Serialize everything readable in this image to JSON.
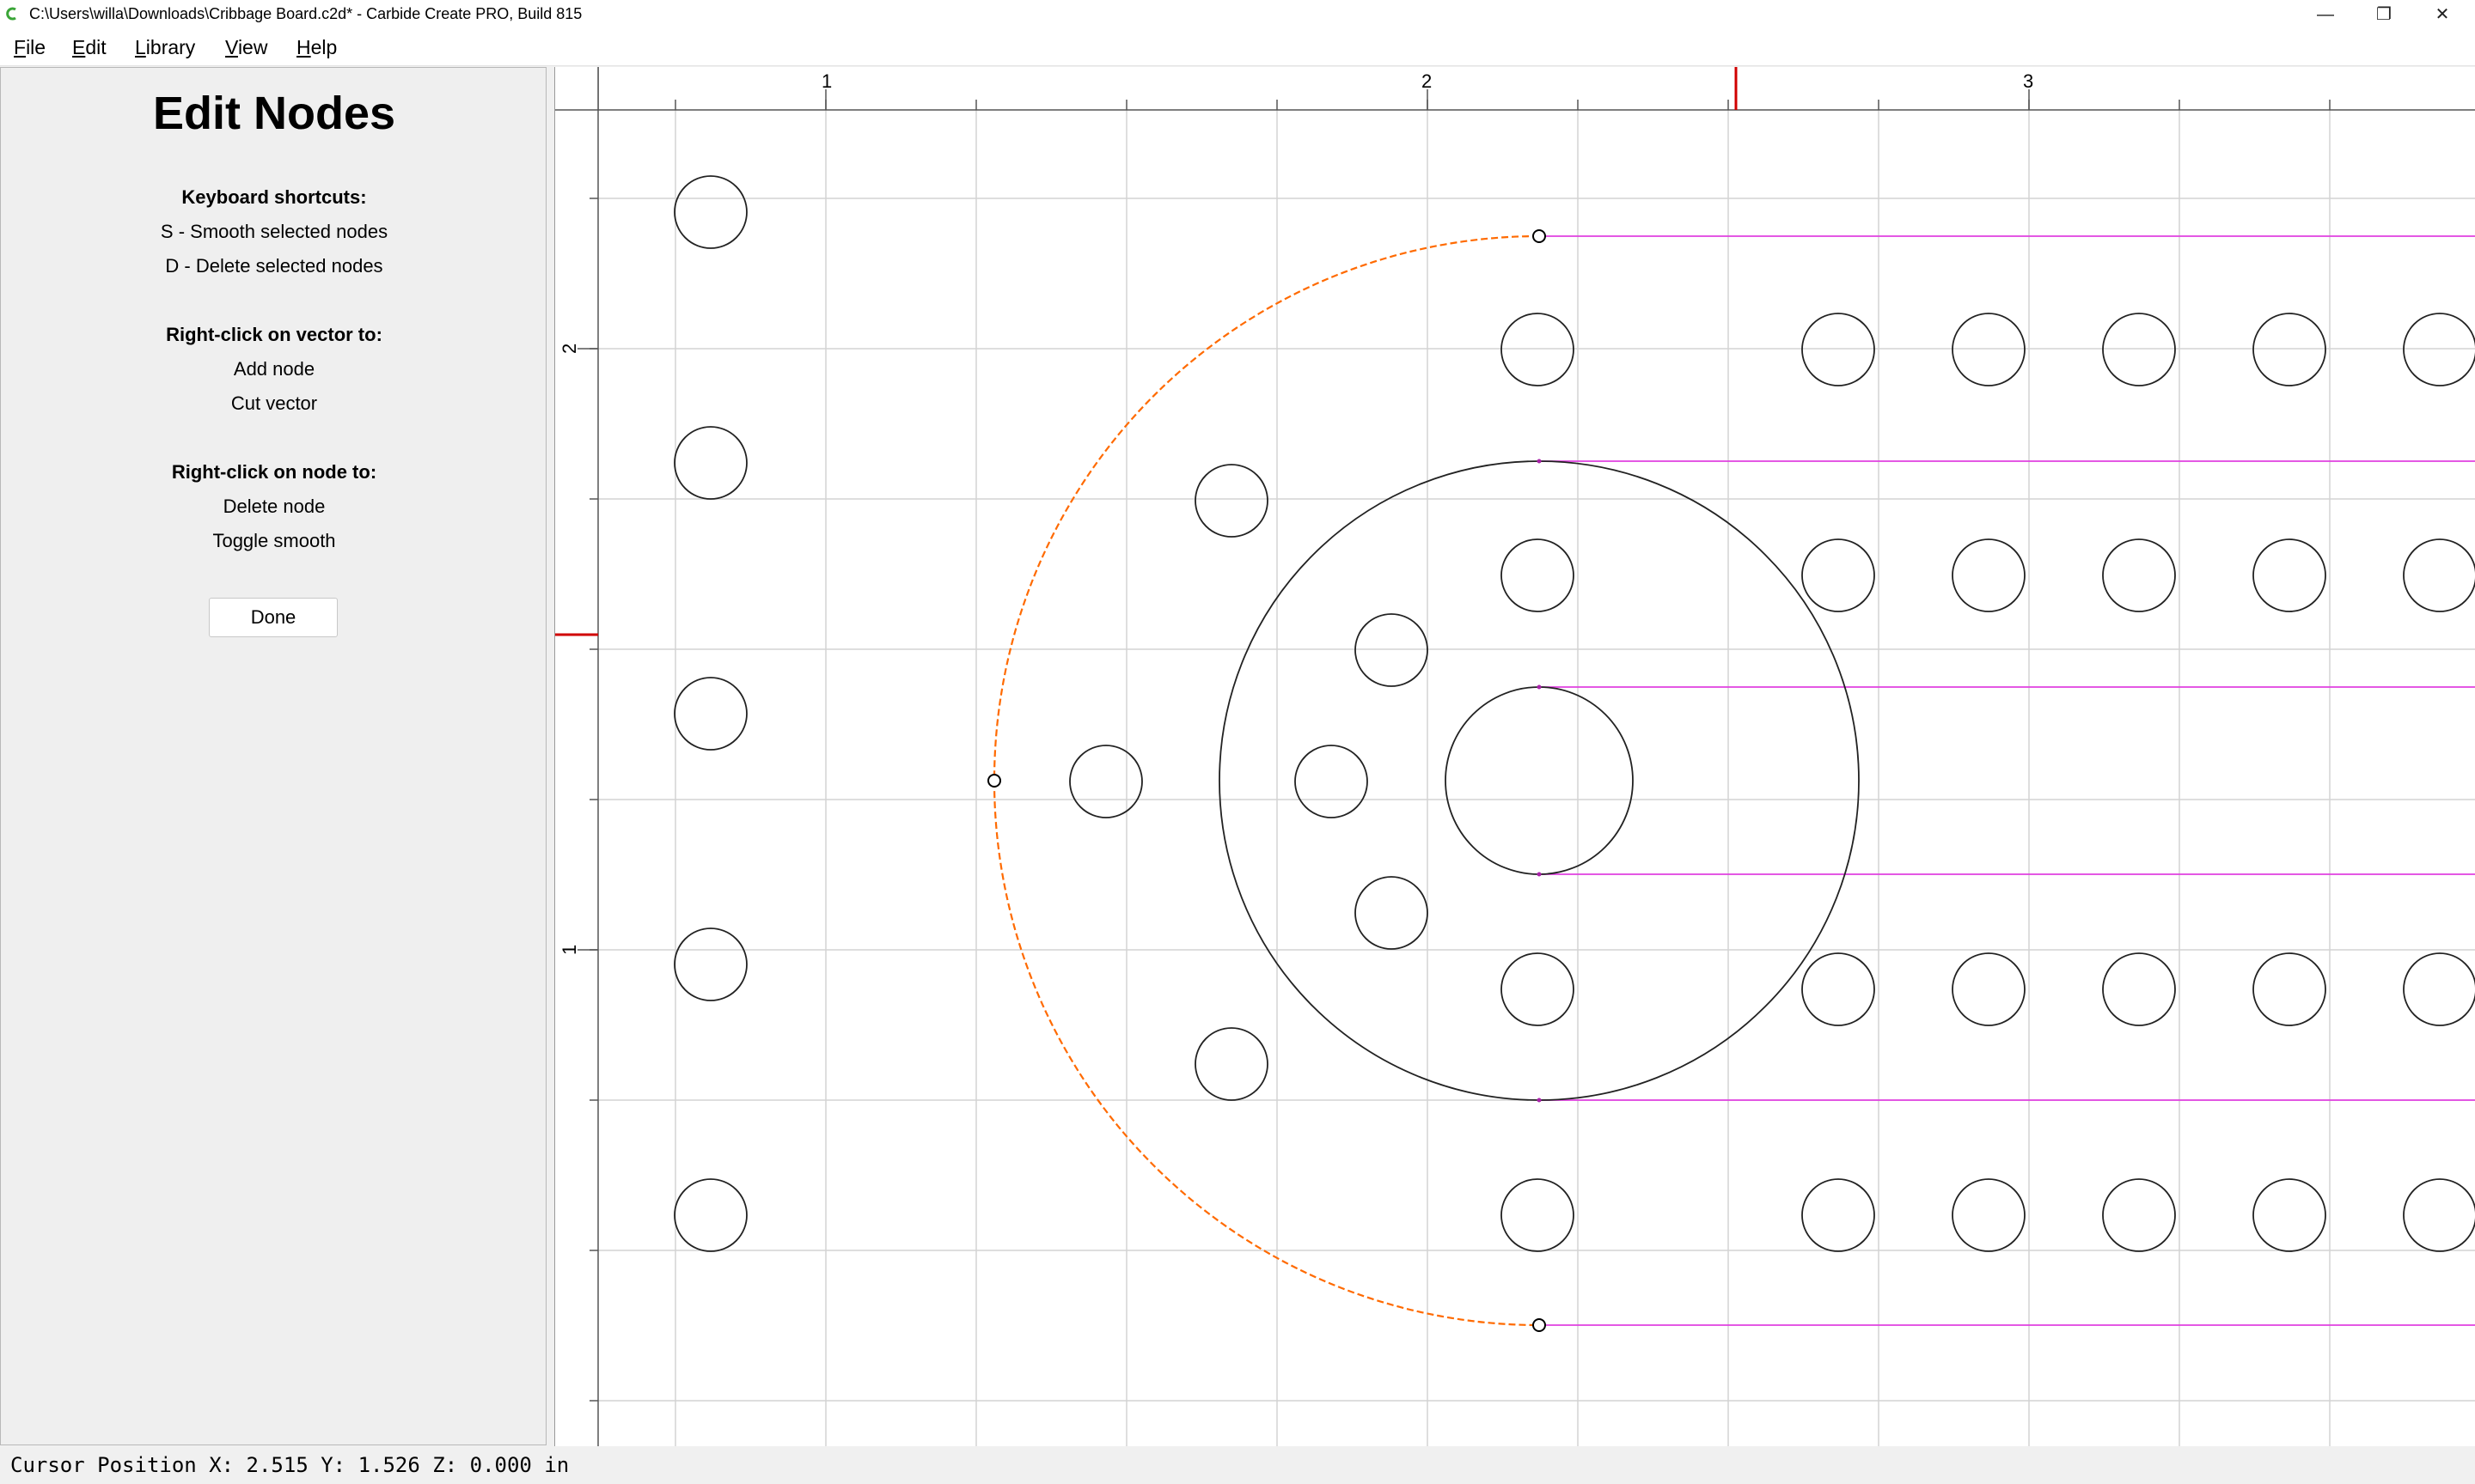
{
  "window": {
    "title": "C:\\Users\\willa\\Downloads\\Cribbage Board.c2d* - Carbide Create PRO, Build 815",
    "minimize_glyph": "—",
    "restore_glyph": "❐",
    "close_glyph": "✕"
  },
  "menu": [
    {
      "label": "File",
      "accel": "F",
      "rest": "ile"
    },
    {
      "label": "Edit",
      "accel": "E",
      "rest": "dit"
    },
    {
      "label": "Library",
      "accel": "L",
      "rest": "ibrary"
    },
    {
      "label": "View",
      "accel": "V",
      "rest": "iew"
    },
    {
      "label": "Help",
      "accel": "H",
      "rest": "elp"
    }
  ],
  "panel": {
    "title": "Edit Nodes",
    "shortcuts_heading": "Keyboard shortcuts:",
    "shortcut_smooth": "S - Smooth selected nodes",
    "shortcut_delete": "D - Delete selected nodes",
    "vector_heading": "Right-click on vector to:",
    "vector_add": "Add node",
    "vector_cut": "Cut vector",
    "node_heading": "Right-click on node to:",
    "node_delete": "Delete node",
    "node_toggle": "Toggle smooth",
    "done_label": "Done"
  },
  "rulers": {
    "top_labels": [
      "1",
      "2",
      "3"
    ],
    "left_labels": [
      "2",
      "1"
    ]
  },
  "colors": {
    "selected_vector": "#ff6a00",
    "guide_lines": "#e040e0",
    "cursor_marker": "#d00000",
    "grid": "#d4d4d4"
  },
  "status": {
    "cursor_position": "Cursor Position X: 2.515 Y: 1.526 Z: 0.000 in"
  }
}
